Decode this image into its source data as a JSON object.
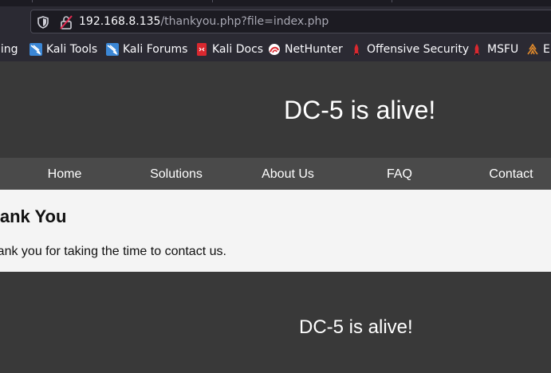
{
  "browser": {
    "url_host": "192.168.8.135",
    "url_path": "/thankyou.php?file=index.php"
  },
  "bookmarks": [
    {
      "label": "hing",
      "icon": "kali-training-icon"
    },
    {
      "label": "Kali Tools",
      "icon": "kali-dragon-icon"
    },
    {
      "label": "Kali Forums",
      "icon": "kali-dragon-icon"
    },
    {
      "label": "Kali Docs",
      "icon": "kali-docs-icon"
    },
    {
      "label": "NetHunter",
      "icon": "nethunter-icon"
    },
    {
      "label": "Offensive Security",
      "icon": "offsec-icon"
    },
    {
      "label": "MSFU",
      "icon": "offsec-icon"
    },
    {
      "label": "E",
      "icon": "exploit-db-icon"
    }
  ],
  "site": {
    "title": "DC-5 is alive!",
    "nav": [
      "Home",
      "Solutions",
      "About Us",
      "FAQ",
      "Contact"
    ],
    "content_title": "Thank You",
    "content_text": "Thank you for taking the time to contact us.",
    "footer_text": "DC-5 is alive!"
  }
}
